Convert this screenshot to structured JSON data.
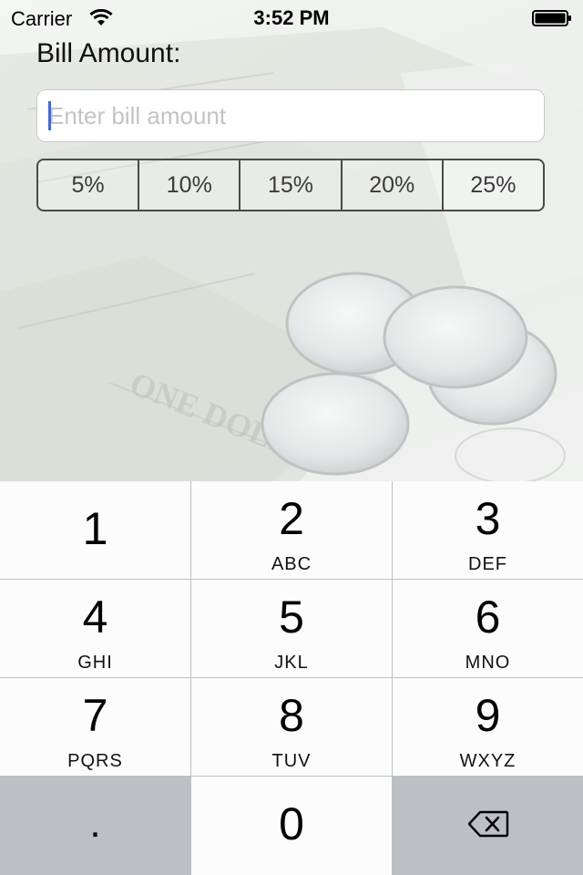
{
  "status_bar": {
    "carrier": "Carrier",
    "time": "3:52 PM",
    "wifi_icon": "wifi-icon",
    "battery_icon": "battery-icon"
  },
  "form": {
    "bill_label": "Bill Amount:",
    "bill_input": {
      "value": "",
      "placeholder": "Enter bill amount"
    },
    "tip_options": [
      "5%",
      "10%",
      "15%",
      "20%",
      "25%"
    ]
  },
  "keypad": {
    "keys": [
      {
        "number": "1",
        "letters": ""
      },
      {
        "number": "2",
        "letters": "ABC"
      },
      {
        "number": "3",
        "letters": "DEF"
      },
      {
        "number": "4",
        "letters": "GHI"
      },
      {
        "number": "5",
        "letters": "JKL"
      },
      {
        "number": "6",
        "letters": "MNO"
      },
      {
        "number": "7",
        "letters": "PQRS"
      },
      {
        "number": "8",
        "letters": "TUV"
      },
      {
        "number": "9",
        "letters": "WXYZ"
      }
    ],
    "decimal": ".",
    "zero": "0",
    "delete_icon": "backspace-icon"
  },
  "colors": {
    "caret": "#3e67e6",
    "keypad_background": "#bcc0c5",
    "key_background": "#fcfcfc"
  }
}
